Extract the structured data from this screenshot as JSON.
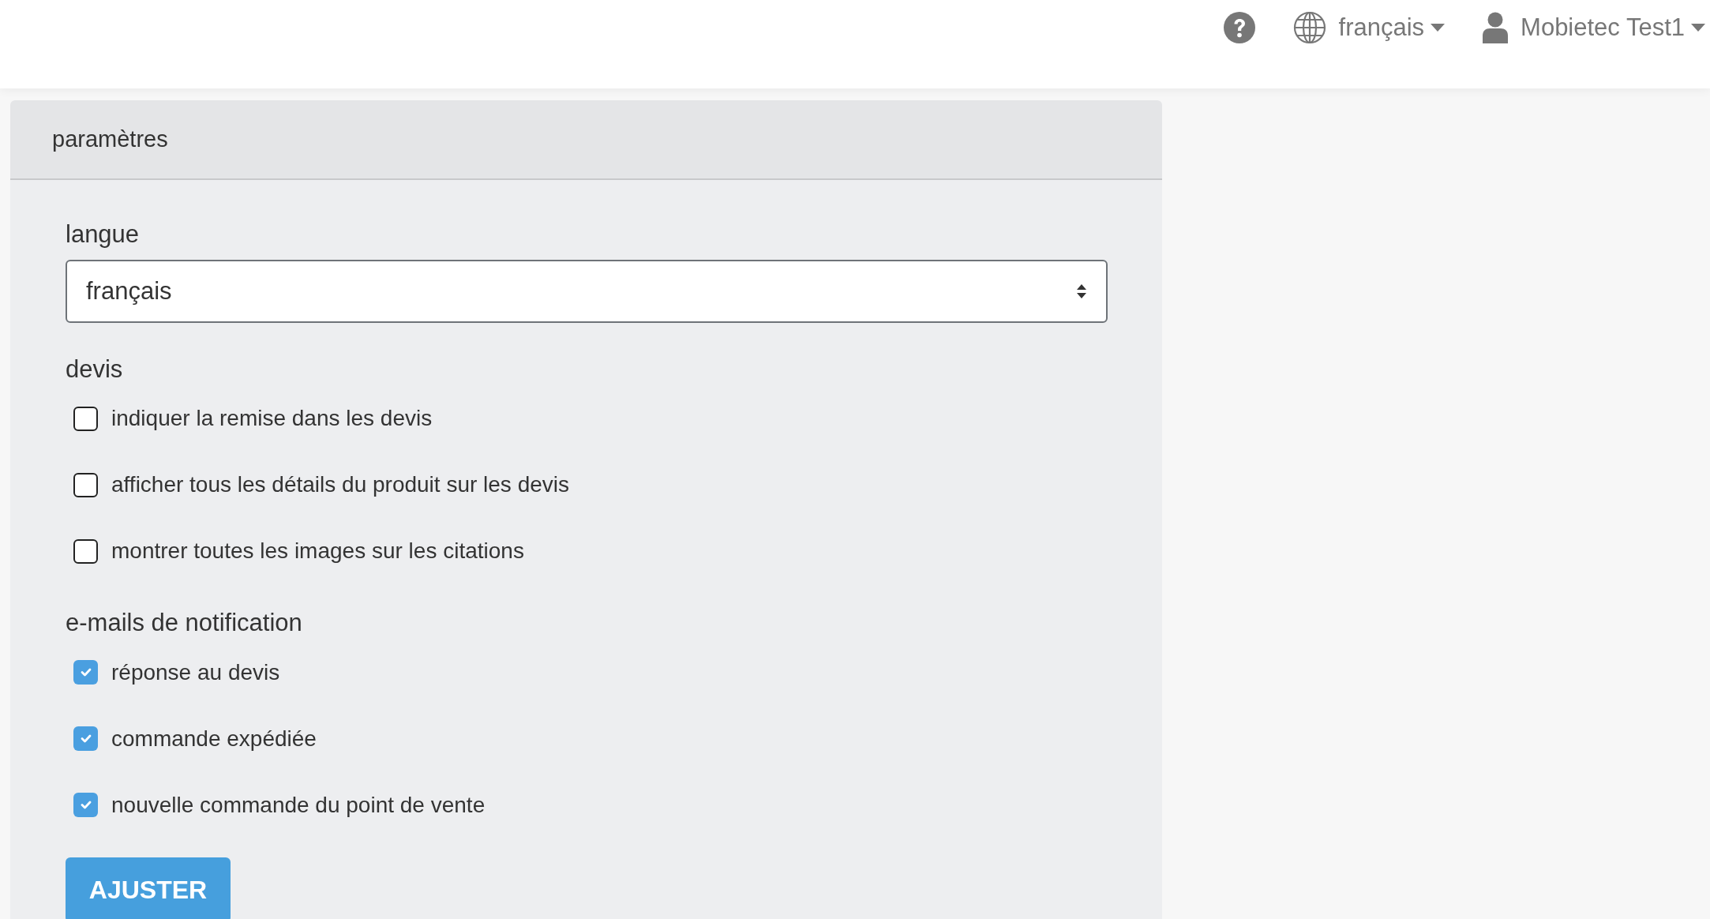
{
  "navbar": {
    "language": "français",
    "user": "Mobietec Test1"
  },
  "card": {
    "title": "paramètres",
    "language_field": {
      "label": "langue",
      "value": "français"
    },
    "sections": [
      {
        "title": "devis",
        "options": [
          {
            "label": "indiquer la remise dans les devis",
            "checked": false
          },
          {
            "label": "afficher tous les détails du produit sur les devis",
            "checked": false
          },
          {
            "label": "montrer toutes les images sur les citations",
            "checked": false
          }
        ]
      },
      {
        "title": "e-mails de notification",
        "options": [
          {
            "label": "réponse au devis",
            "checked": true
          },
          {
            "label": "commande expédiée",
            "checked": true
          },
          {
            "label": "nouvelle commande du point de vente",
            "checked": true
          }
        ]
      }
    ],
    "submit": "AJUSTER"
  }
}
